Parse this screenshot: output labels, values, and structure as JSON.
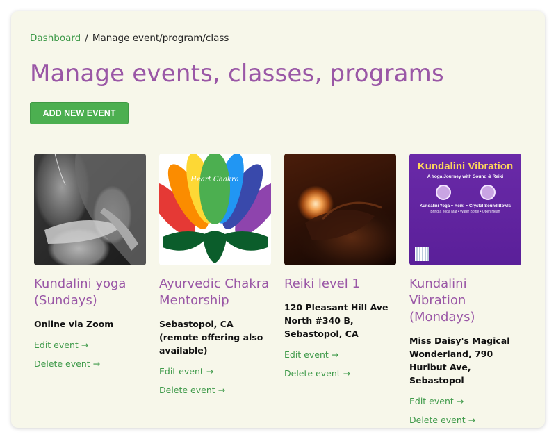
{
  "breadcrumb": {
    "home": "Dashboard",
    "separator": "/",
    "current": "Manage event/program/class"
  },
  "page": {
    "title": "Manage events, classes, programs",
    "add_button": "ADD NEW EVENT"
  },
  "colors": {
    "panel_bg": "#f7f7ea",
    "accent_purple": "#9a57a6",
    "accent_green": "#4caf50",
    "link_green": "#3f9a4a"
  },
  "events": [
    {
      "title": "Kundalini yoga (Sundays)",
      "location": "Online via Zoom",
      "edit_label": "Edit event →",
      "delete_label": "Delete event →"
    },
    {
      "title": "Ayurvedic Chakra Mentorship",
      "location": "Sebastopol, CA (remote offering also available)",
      "edit_label": "Edit event →",
      "delete_label": "Delete event →",
      "thumb_text": "Heart Chakra"
    },
    {
      "title": "Reiki level 1",
      "location": "120 Pleasant Hill Ave North #340 B, Sebastopol, CA",
      "edit_label": "Edit event →",
      "delete_label": "Delete event →"
    },
    {
      "title": "Kundalini Vibration (Mondays)",
      "location": "Miss Daisy's Magical Wonderland, 790 Hurlbut Ave, Sebastopol",
      "edit_label": "Edit event →",
      "delete_label": "Delete event →",
      "thumb_title": "Kundalini Vibration",
      "thumb_subtitle": "A Yoga Journey with Sound & Reiki",
      "thumb_line": "Kundalini Yoga ~ Reiki ~ Crystal Sound Bowls",
      "thumb_footer": "Bring a Yoga Mat • Water Bottle • Open Heart"
    }
  ]
}
